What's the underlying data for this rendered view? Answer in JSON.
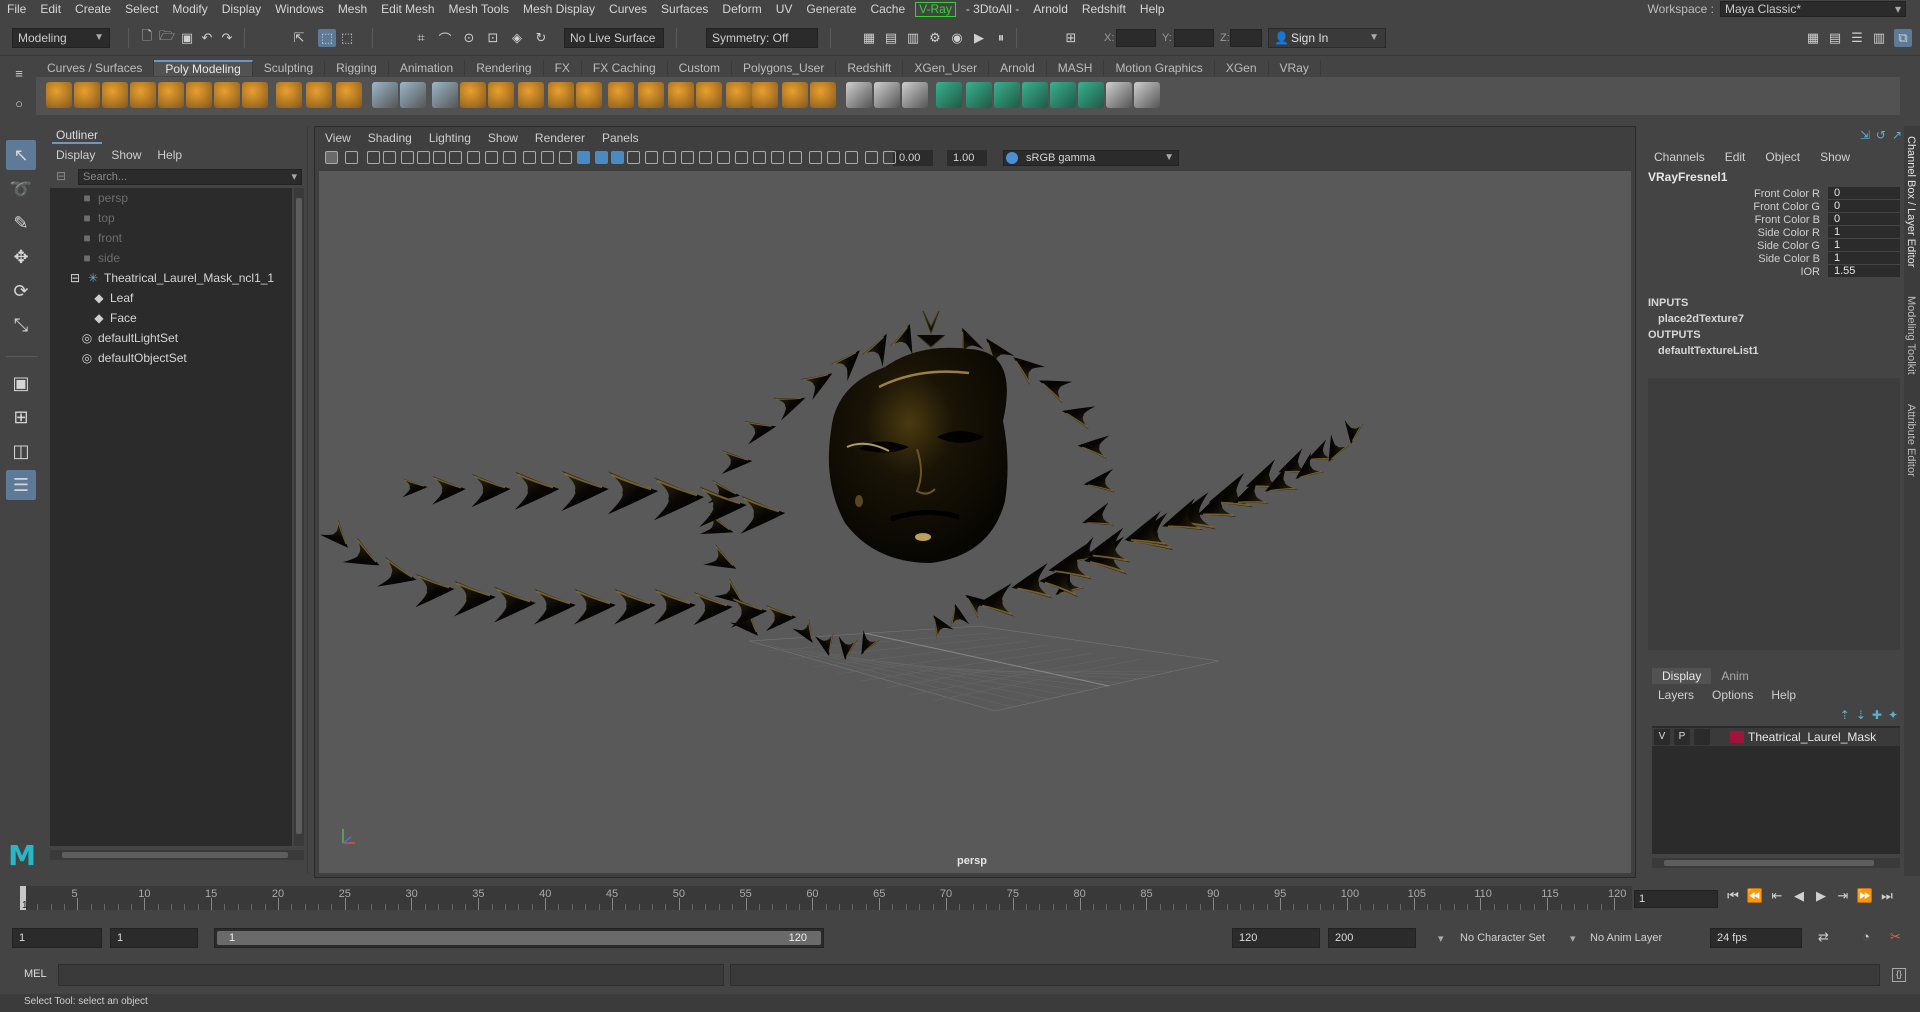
{
  "menubar": {
    "items": [
      "File",
      "Edit",
      "Create",
      "Select",
      "Modify",
      "Display",
      "Windows",
      "Mesh",
      "Edit Mesh",
      "Mesh Tools",
      "Mesh Display",
      "Curves",
      "Surfaces",
      "Deform",
      "UV",
      "Generate",
      "Cache",
      "V-Ray",
      "- 3DtoAll -",
      "Arnold",
      "Redshift",
      "Help"
    ],
    "workspace_label": "Workspace :",
    "workspace_value": "Maya Classic*"
  },
  "statusline": {
    "mode": "Modeling",
    "live_surface": "No Live Surface",
    "symmetry": "Symmetry: Off",
    "coord_x": "X:",
    "coord_y": "Y:",
    "coord_z": "Z:",
    "sign_in": "Sign In"
  },
  "shelf": {
    "tabs": [
      "Curves / Surfaces",
      "Poly Modeling",
      "Sculpting",
      "Rigging",
      "Animation",
      "Rendering",
      "FX",
      "FX Caching",
      "Custom",
      "Polygons_User",
      "Redshift",
      "XGen_User",
      "Arnold",
      "MASH",
      "Motion Graphics",
      "XGen",
      "VRay"
    ],
    "selected": "Poly Modeling"
  },
  "outliner": {
    "title": "Outliner",
    "menus": [
      "Display",
      "Show",
      "Help"
    ],
    "search_placeholder": "Search...",
    "items": [
      {
        "label": "persp",
        "indent": 1,
        "icon": "camera-icon",
        "dim": true
      },
      {
        "label": "top",
        "indent": 1,
        "icon": "camera-icon",
        "dim": true
      },
      {
        "label": "front",
        "indent": 1,
        "icon": "camera-icon",
        "dim": true
      },
      {
        "label": "side",
        "indent": 1,
        "icon": "camera-icon",
        "dim": true
      },
      {
        "label": "Theatrical_Laurel_Mask_ncl1_1",
        "indent": 0,
        "icon": "group-icon",
        "dim": false
      },
      {
        "label": "Leaf",
        "indent": 2,
        "icon": "mesh-icon",
        "dim": false
      },
      {
        "label": "Face",
        "indent": 2,
        "icon": "mesh-icon",
        "dim": false
      },
      {
        "label": "defaultLightSet",
        "indent": 1,
        "icon": "set-icon",
        "dim": false
      },
      {
        "label": "defaultObjectSet",
        "indent": 1,
        "icon": "set-icon",
        "dim": false
      }
    ]
  },
  "viewport": {
    "menus": [
      "View",
      "Shading",
      "Lighting",
      "Show",
      "Renderer",
      "Panels"
    ],
    "exposure": "0.00",
    "gamma": "1.00",
    "color_space": "sRGB gamma",
    "camera": "persp"
  },
  "channelbox": {
    "menus": [
      "Channels",
      "Edit",
      "Object",
      "Show"
    ],
    "node": "VRayFresnel1",
    "attrs": [
      {
        "name": "Front Color R",
        "value": "0"
      },
      {
        "name": "Front Color G",
        "value": "0"
      },
      {
        "name": "Front Color B",
        "value": "0"
      },
      {
        "name": "Side Color R",
        "value": "1"
      },
      {
        "name": "Side Color G",
        "value": "1"
      },
      {
        "name": "Side Color B",
        "value": "1"
      },
      {
        "name": "IOR",
        "value": "1.55"
      }
    ],
    "inputs_label": "INPUTS",
    "inputs": [
      "place2dTexture7"
    ],
    "outputs_label": "OUTPUTS",
    "outputs": [
      "defaultTextureList1"
    ]
  },
  "sidetabs": [
    "Channel Box / Layer Editor",
    "Modeling Toolkit",
    "Attribute Editor"
  ],
  "layers": {
    "tabs": [
      "Display",
      "Anim"
    ],
    "menus": [
      "Layers",
      "Options",
      "Help"
    ],
    "layer": {
      "v": "V",
      "p": "P",
      "name": "Theatrical_Laurel_Mask",
      "color": "#a3123a"
    }
  },
  "timeslider": {
    "ticks": [
      5,
      10,
      15,
      20,
      25,
      30,
      35,
      40,
      45,
      50,
      55,
      60,
      65,
      70,
      75,
      80,
      85,
      90,
      95,
      100,
      105,
      110,
      115,
      120
    ],
    "current_frame": "1",
    "frame_box": "1"
  },
  "range": {
    "start": "1",
    "anim_start": "1",
    "bar_left": "1",
    "bar_right": "120",
    "range_end": "120",
    "anim_end": "200",
    "character_set": "No Character Set",
    "anim_layer": "No Anim Layer",
    "fps": "24 fps"
  },
  "cmdline": {
    "lang": "MEL"
  },
  "helpline": {
    "text": "Select Tool: select an object"
  },
  "colors": {
    "ui_bg": "#444444",
    "panel_dark": "#2b2b2b",
    "viewport_bg": "#595959",
    "selection_blue": "#5d7a99",
    "shelf_green": "#3bb08f",
    "shelf_orange": "#e8a030",
    "vray_green": "#3ad13a"
  }
}
